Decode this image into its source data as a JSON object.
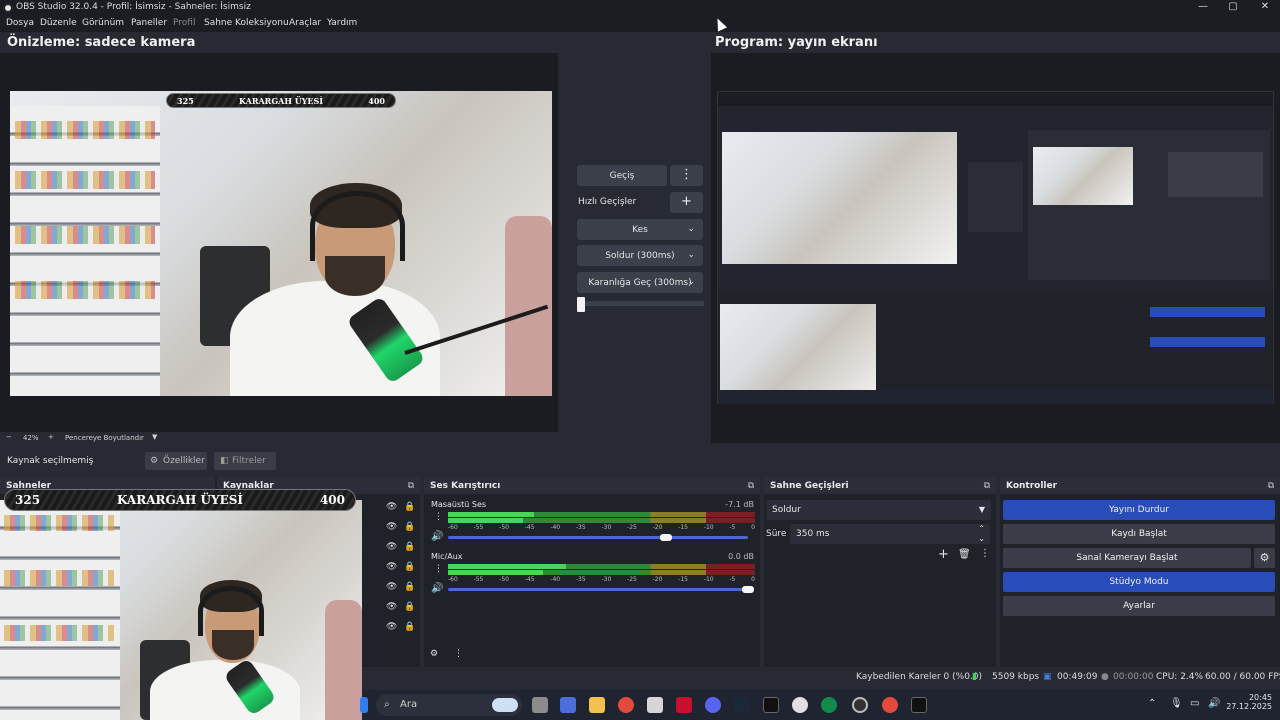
{
  "window": {
    "title": "OBS Studio 32.0.4 - Profil: İsimsiz - Sahneler: İsimsiz",
    "minimize": "—",
    "maximize": "▢",
    "close": "✕"
  },
  "menu": [
    "Dosya",
    "Düzenle",
    "Görünüm",
    "Paneller",
    "Profil",
    "Sahne Koleksiyonu",
    "Araçlar",
    "Yardım"
  ],
  "preview": {
    "title": "Önizleme: sadece kamera",
    "zoom": "42%",
    "zoom_out": "−",
    "zoom_in": "+",
    "fit_label": "Pencereye Boyutlandır"
  },
  "program": {
    "title": "Program: yayın ekranı"
  },
  "badge": {
    "left": "325",
    "center": "KARARGAH ÜYESİ",
    "right": "400"
  },
  "transitions": {
    "transition_button": "Geçiş",
    "quick_label": "Hızlı Geçişler",
    "items": [
      "Kes",
      "Soldur (300ms)",
      "Karanlığa Geç (300ms)"
    ]
  },
  "source_toolbar": {
    "none_selected": "Kaynak seçilmemiş",
    "properties": "Özellikler",
    "filters": "Filtreler"
  },
  "docks": {
    "scenes": "Sahneler",
    "sources": "Kaynaklar",
    "mixer": "Ses Karıştırıcı",
    "scene_transitions": "Sahne Geçişleri",
    "controls": "Kontroller"
  },
  "mixer": {
    "channels": [
      {
        "name": "Masaüstü Ses",
        "db": "-7.1 dB",
        "level": 0.28,
        "volume": 0.96
      },
      {
        "name": "Mic/Aux",
        "db": "0.0 dB",
        "level": 0.4,
        "volume": 1.0
      }
    ],
    "ticks": [
      "-60",
      "-55",
      "-50",
      "-45",
      "-40",
      "-35",
      "-30",
      "-25",
      "-20",
      "-15",
      "-10",
      "-5",
      "0"
    ]
  },
  "scene_transitions": {
    "selected": "Soldur",
    "duration_label": "Süre",
    "duration_value": "350 ms"
  },
  "controls": {
    "buttons": [
      {
        "label": "Yayını Durdur",
        "active": true
      },
      {
        "label": "Kaydı Başlat",
        "active": false
      },
      {
        "label": "Sanal Kamerayı Başlat",
        "active": false
      },
      {
        "label": "Stüdyo Modu",
        "active": true
      },
      {
        "label": "Ayarlar",
        "active": false
      }
    ]
  },
  "status": {
    "dropped": "Kaybedilen Kareler 0 (%0.0)",
    "bitrate": "5509 kbps",
    "stream_time": "00:49:09",
    "rec_time": "00:00:00",
    "cpu": "CPU: 2.4%",
    "fps": "60.00 / 60.00 FPS"
  },
  "taskbar": {
    "search_placeholder": "Ara",
    "time": "20:45",
    "date": "27.12.2025"
  },
  "colors": {
    "accent": "#284cb8",
    "background": "#272a33",
    "dock": "#1f2229",
    "button": "#3c404b"
  }
}
